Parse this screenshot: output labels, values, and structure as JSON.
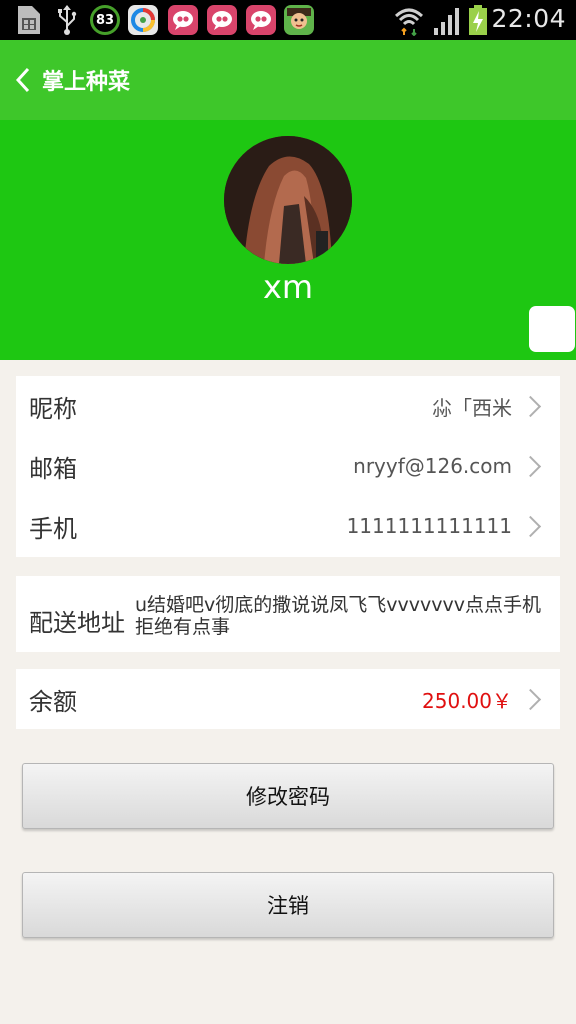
{
  "status_bar": {
    "time": "22:04",
    "battery_level_text": "83",
    "icons": [
      "sim-card-icon",
      "usb-icon",
      "battery-ring-icon",
      "app-browser-icon",
      "app-chat-icon",
      "app-chat-icon",
      "app-chat-icon",
      "game-character-icon",
      "wifi-icon",
      "signal-icon",
      "battery-charging-icon"
    ]
  },
  "titlebar": {
    "back_icon": "chevron-left-icon",
    "title": "掌上种菜",
    "color": "#3ec72a"
  },
  "header": {
    "username": "xm",
    "color": "#1ec712"
  },
  "profile": {
    "rows": [
      {
        "label": "昵称",
        "value": "尛「西米"
      },
      {
        "label": "邮箱",
        "value": "nryyf@126.com"
      },
      {
        "label": "手机",
        "value": "1111111111111"
      }
    ],
    "address": {
      "label": "配送地址",
      "value": "u结婚吧v彻底的撒说说凤飞飞vvvvvvv点点手机拒绝有点事"
    },
    "balance": {
      "label": "余额",
      "value": "250.00￥",
      "color": "#e01010"
    }
  },
  "buttons": {
    "change_password": "修改密码",
    "logout": "注销"
  }
}
